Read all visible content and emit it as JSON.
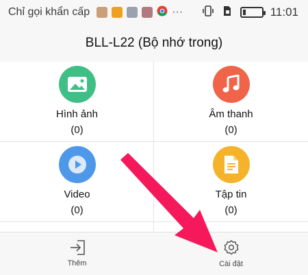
{
  "status_bar": {
    "carrier": "Chỉ gọi khẩn cấp",
    "more": "···",
    "time": "11:01",
    "icons": [
      "photo-icon",
      "lock-app-icon",
      "gallery-icon",
      "contact-photo-icon",
      "chrome-icon",
      "vibrate-icon",
      "sim-icon",
      "battery-icon"
    ]
  },
  "title": "BLL-L22 (Bộ nhớ trong)",
  "categories": [
    {
      "label": "Hình ảnh",
      "count": "(0)",
      "icon": "image-icon",
      "color": "#3fbf86"
    },
    {
      "label": "Âm thanh",
      "count": "(0)",
      "icon": "music-note-icon",
      "color": "#f0644a"
    },
    {
      "label": "Video",
      "count": "(0)",
      "icon": "play-icon",
      "color": "#4d98e8"
    },
    {
      "label": "Tập tin",
      "count": "(0)",
      "icon": "document-icon",
      "color": "#f4b32b"
    }
  ],
  "bottom_bar": {
    "add_label": "Thêm",
    "settings_label": "Cài đặt"
  },
  "colors": {
    "arrow": "#f5195c",
    "background": "#f7f7f7"
  }
}
